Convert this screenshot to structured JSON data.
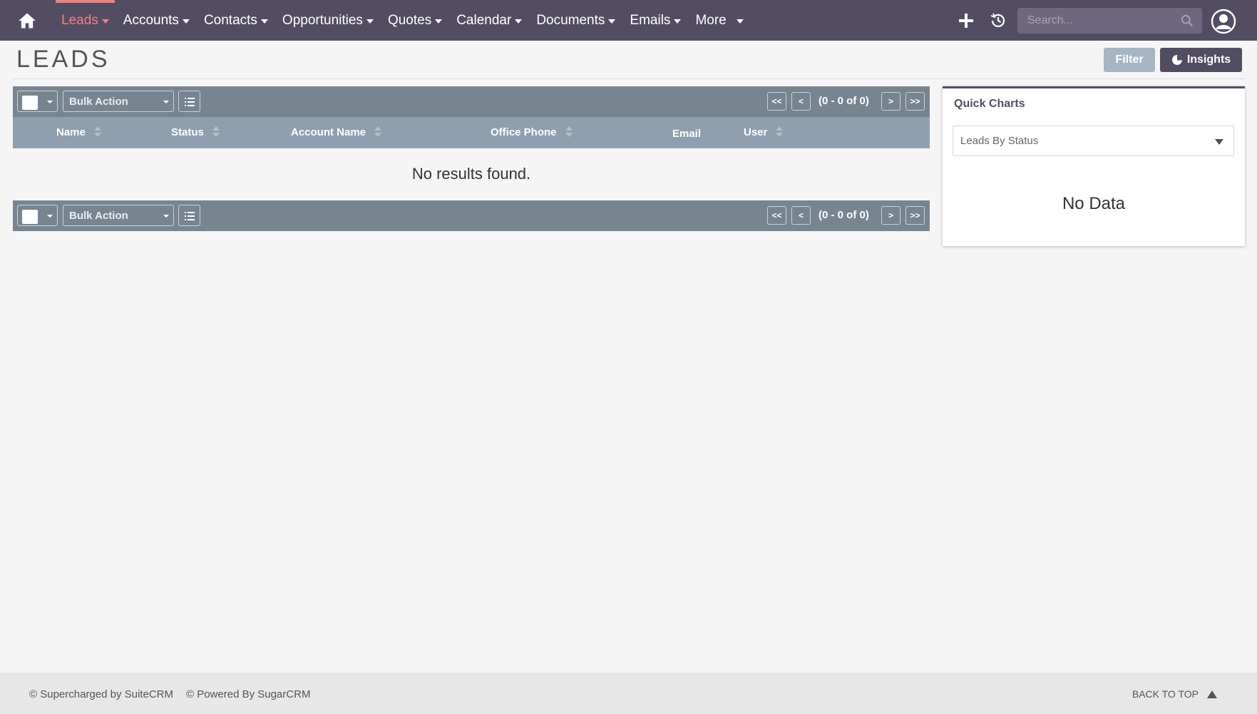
{
  "nav": {
    "items": [
      {
        "label": "Leads",
        "active": true
      },
      {
        "label": "Accounts"
      },
      {
        "label": "Contacts"
      },
      {
        "label": "Opportunities"
      },
      {
        "label": "Quotes"
      },
      {
        "label": "Calendar"
      },
      {
        "label": "Documents"
      },
      {
        "label": "Emails"
      },
      {
        "label": "More"
      }
    ],
    "search_placeholder": "Search...",
    "icons": [
      "home-icon",
      "plus-icon",
      "history-icon",
      "search-icon",
      "user-icon"
    ]
  },
  "page": {
    "title": "LEADS",
    "filter_label": "Filter",
    "insights_label": "Insights"
  },
  "list": {
    "bulk_action_label": "Bulk Action",
    "pagination": {
      "first": "<<",
      "prev": "<",
      "count": "(0 - 0 of 0)",
      "next": ">",
      "last": ">>"
    },
    "columns": [
      {
        "label": "Name",
        "sortable": true
      },
      {
        "label": "Status",
        "sortable": true
      },
      {
        "label": "Account Name",
        "sortable": true
      },
      {
        "label": "Office Phone",
        "sortable": true
      },
      {
        "label": "Email",
        "sortable": false
      },
      {
        "label": "User",
        "sortable": true
      }
    ],
    "empty_message": "No results found."
  },
  "quick_charts": {
    "title": "Quick Charts",
    "selected_chart": "Leads By Status",
    "empty_message": "No Data"
  },
  "footer": {
    "supercharged": "© Supercharged by SuiteCRM",
    "powered": "© Powered By SugarCRM",
    "back_to_top": "BACK TO TOP"
  },
  "colors": {
    "nav_bg": "#534d64",
    "accent": "#f08377",
    "action_bar": "#778591",
    "column_header": "#8e9faf",
    "filter_button": "#a5b6c4"
  }
}
